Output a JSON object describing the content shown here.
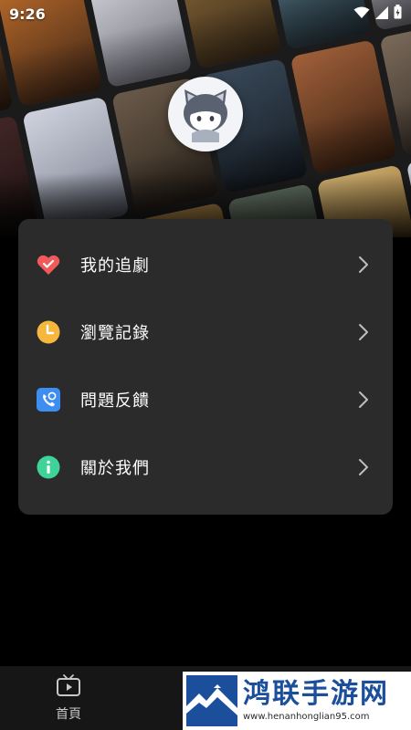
{
  "status_bar": {
    "time": "9:26",
    "icons": [
      "wifi-icon",
      "cellular-signal-icon",
      "battery-icon"
    ]
  },
  "header": {
    "avatar": "avatar-mascot"
  },
  "menu": {
    "items": [
      {
        "label": "我的追劇",
        "icon": "heart-check-icon",
        "icon_color": "#f25a5a"
      },
      {
        "label": "瀏覽記錄",
        "icon": "clock-icon",
        "icon_color": "#f6b73c"
      },
      {
        "label": "問題反饋",
        "icon": "phone-feedback-icon",
        "icon_color": "#3d8ef0"
      },
      {
        "label": "關於我們",
        "icon": "info-icon",
        "icon_color": "#3fd39a"
      }
    ]
  },
  "bottom_nav": {
    "home_label": "首頁",
    "home_icon": "tv-play-icon"
  },
  "watermark": {
    "title": "鸿联手游网",
    "url": "www.henanhonglian95.com"
  }
}
